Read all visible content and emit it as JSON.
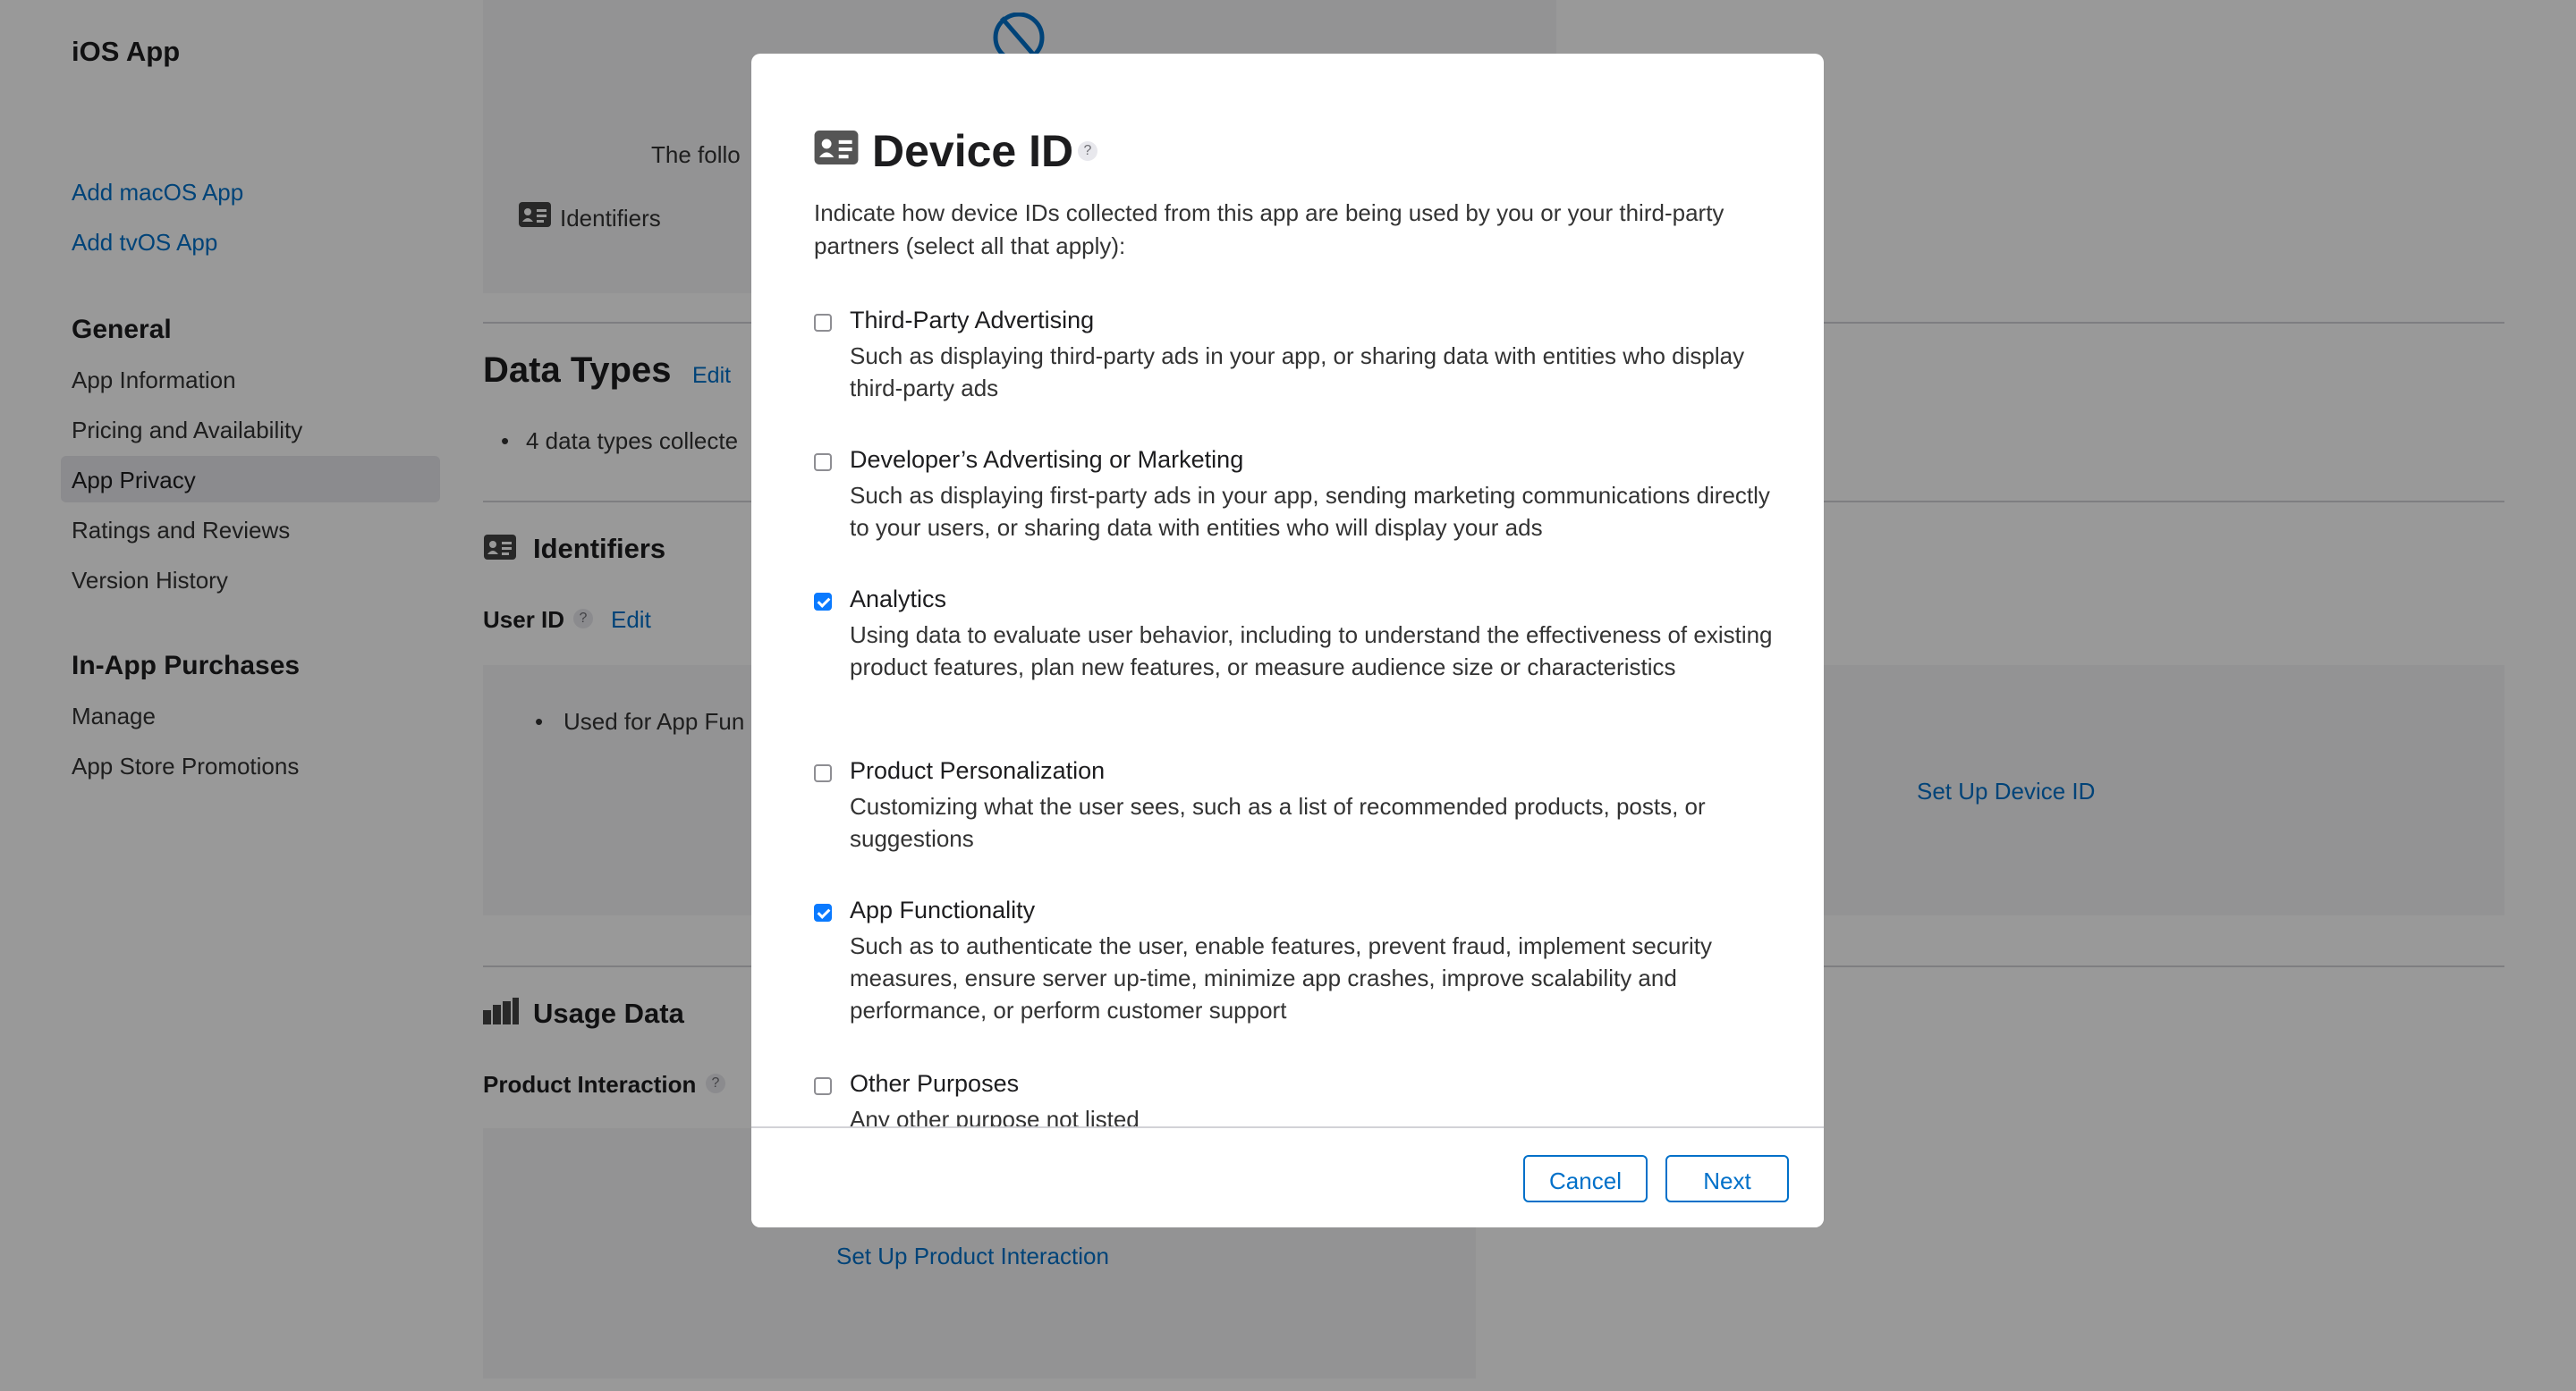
{
  "sidebar": {
    "app_title": "iOS App",
    "add_links": [
      "Add macOS App",
      "Add tvOS App"
    ],
    "general_heading": "General",
    "general_items": [
      "App Information",
      "Pricing and Availability",
      "App Privacy",
      "Ratings and Reviews",
      "Version History"
    ],
    "iap_heading": "In-App Purchases",
    "iap_items": [
      "Manage",
      "App Store Promotions"
    ]
  },
  "main": {
    "intro_partial": "The follo",
    "identifiers_chip": "Identifiers",
    "data_types_heading": "Data Types",
    "data_types_edit": "Edit",
    "data_types_bullet": "4 data types collecte",
    "identifiers_heading": "Identifiers",
    "user_id_label": "User ID",
    "question_mark": "?",
    "user_id_edit": "Edit",
    "user_id_bullet": "Used for App Fun",
    "setup_device_id": "Set Up Device ID",
    "usage_data_heading": "Usage Data",
    "product_interaction_label": "Product Interaction",
    "setup_product_interaction": "Set Up Product Interaction"
  },
  "modal": {
    "title": "Device ID",
    "help": "?",
    "intro": "Indicate how device IDs collected from this app are being used by you or your third-party partners (select all that apply):",
    "options": [
      {
        "label": "Third-Party Advertising",
        "description": "Such as displaying third-party ads in your app, or sharing data with entities who display third-party ads",
        "checked": false
      },
      {
        "label": "Developer’s Advertising or Marketing",
        "description": "Such as displaying first-party ads in your app, sending marketing communications directly to your users, or sharing data with entities who will display your ads",
        "checked": false
      },
      {
        "label": "Analytics",
        "description": "Using data to evaluate user behavior, including to understand the effectiveness of existing product features, plan new features, or measure audience size or characteristics",
        "checked": true
      },
      {
        "label": "Product Personalization",
        "description": "Customizing what the user sees, such as a list of recommended products, posts, or suggestions",
        "checked": false
      },
      {
        "label": "App Functionality",
        "description": "Such as to authenticate the user, enable features, prevent fraud, implement security measures, ensure server up-time, minimize app crashes, improve scalability and performance, or perform customer support",
        "checked": true
      },
      {
        "label": "Other Purposes",
        "description": "Any other purpose not listed",
        "checked": false
      }
    ],
    "cancel_label": "Cancel",
    "next_label": "Next"
  },
  "colors": {
    "accent": "#0070c9",
    "checkbox_checked": "#0a7aff",
    "overlay": "rgba(0,0,0,0.40)"
  }
}
